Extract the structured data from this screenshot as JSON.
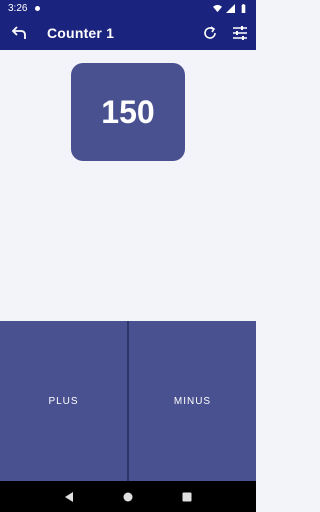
{
  "status_bar": {
    "time": "3:26"
  },
  "app_bar": {
    "title": "Counter 1"
  },
  "counter": {
    "value": "150"
  },
  "buttons": {
    "plus_label": "PLUS",
    "minus_label": "MINUS"
  },
  "colors": {
    "primary": "#1a237e",
    "accent": "#4a5190",
    "background": "#f3f4f9"
  },
  "icons": {
    "back": "back-arrow-icon",
    "reset": "refresh-icon",
    "settings": "tune-icon"
  }
}
